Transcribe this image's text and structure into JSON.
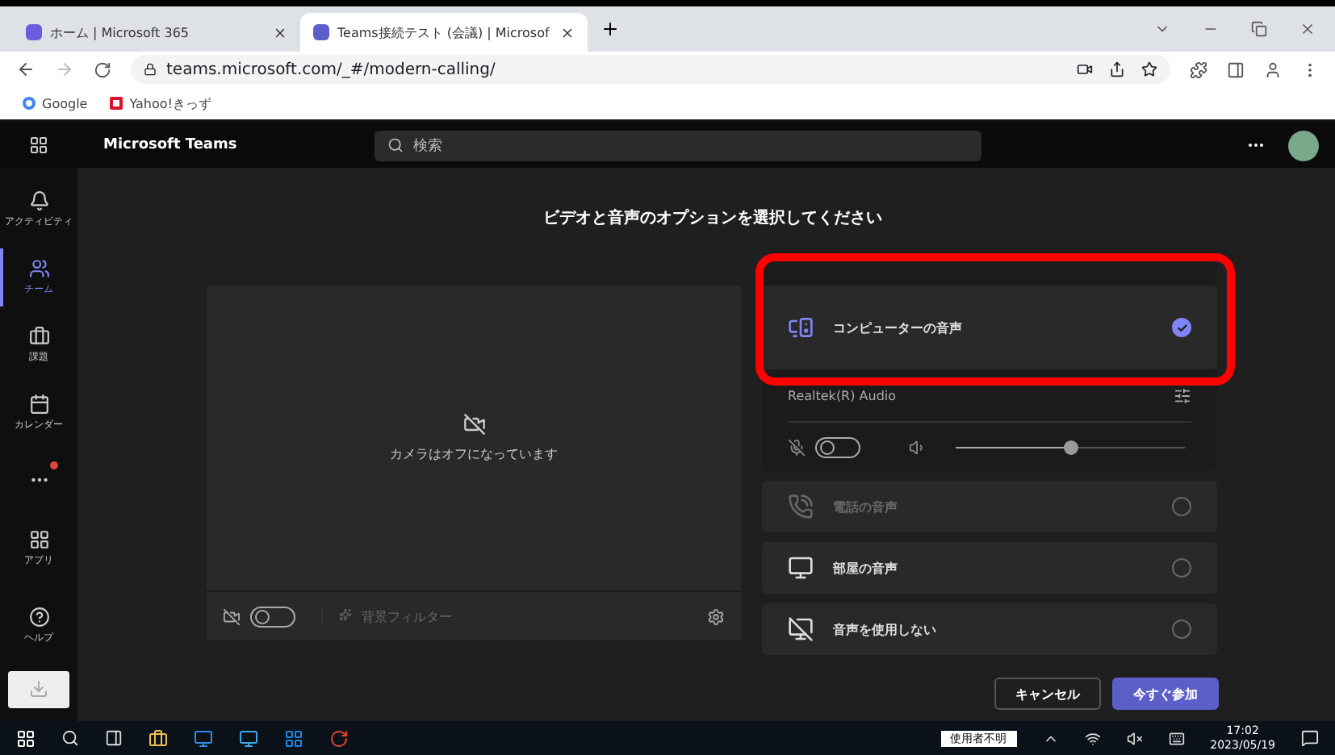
{
  "browser": {
    "tabs": [
      {
        "label": "ホーム | Microsoft 365",
        "selected": false,
        "kind": "m365"
      },
      {
        "label": "Teams接続テスト (会議) | Microsof",
        "selected": true,
        "kind": "teams"
      }
    ],
    "url": "teams.microsoft.com/_#/modern-calling/",
    "bookmarks": [
      {
        "label": "Google",
        "kind": "google"
      },
      {
        "label": "Yahoo!きっず",
        "kind": "yahoo"
      }
    ]
  },
  "teams": {
    "app_name": "Microsoft Teams",
    "search": {
      "placeholder": "検索"
    },
    "rail": [
      {
        "label": "アクティビティ",
        "kind": "bell",
        "selected": false,
        "badge": false
      },
      {
        "label": "チーム",
        "kind": "teams",
        "selected": true,
        "badge": false
      },
      {
        "label": "課題",
        "kind": "bag",
        "selected": false,
        "badge": false
      },
      {
        "label": "カレンダー",
        "kind": "calendar",
        "selected": false,
        "badge": false
      },
      {
        "kind": "more",
        "selected": false,
        "badge": true
      },
      {
        "label": "アプリ",
        "kind": "apps",
        "selected": false,
        "badge": false
      }
    ],
    "help": {
      "label": "ヘルプ"
    }
  },
  "prejoin": {
    "title": "ビデオと音声のオプションを選択してください",
    "camera": {
      "on": false,
      "message": "カメラはオフになっています",
      "background_filter": "背景フィルター"
    },
    "highlight_frame": true,
    "audio_options": [
      {
        "label": "コンピューターの音声",
        "kind": "computer",
        "selected": true,
        "disabled": false
      },
      {
        "label": "電話の音声",
        "kind": "phone",
        "selected": false,
        "disabled": true
      },
      {
        "label": "部屋の音声",
        "kind": "room",
        "selected": false,
        "disabled": false
      },
      {
        "label": "音声を使用しない",
        "kind": "none",
        "selected": false,
        "disabled": false
      }
    ],
    "device": "Realtek(R) Audio",
    "mic_on": false,
    "speaker": {
      "level": 0.5
    },
    "buttons": [
      {
        "label": "キャンセル",
        "kind": "secondary"
      },
      {
        "label": "今すぐ参加",
        "kind": "primary"
      }
    ]
  },
  "taskbar": {
    "ime": "使用者不明",
    "time": "17:02",
    "date": "2023/05/19"
  }
}
